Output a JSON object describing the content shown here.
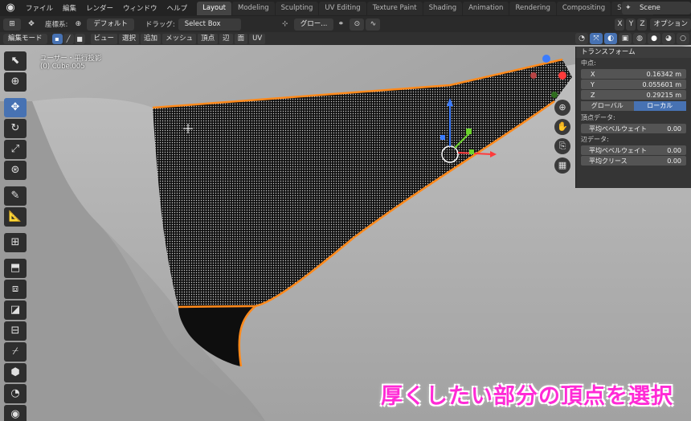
{
  "menu": [
    "ファイル",
    "編集",
    "レンダー",
    "ウィンドウ",
    "ヘルプ"
  ],
  "workspaces": [
    "Layout",
    "Modeling",
    "Sculpting",
    "UV Editing",
    "Texture Paint",
    "Shading",
    "Animation",
    "Rendering",
    "Compositing",
    "Scripting"
  ],
  "active_workspace": "Layout",
  "scene_name": "Scene",
  "toolbar2": {
    "coord_label": "座標系:",
    "coord_value": "デフォルト",
    "drag_label": "ドラッグ:",
    "drag_value": "Select Box",
    "pivot_value": "グロー...",
    "xyz": [
      "X",
      "Y",
      "Z"
    ],
    "options": "オプション"
  },
  "toolbar3": {
    "mode": "編集モード",
    "menus": [
      "ビュー",
      "選択",
      "追加",
      "メッシュ",
      "頂点",
      "辺",
      "面",
      "UV"
    ]
  },
  "viewport": {
    "view_name": "ユーザー・平行投影",
    "object_name": "(0) Cube.005"
  },
  "npanel": {
    "header": "トランスフォーム",
    "median_label": "中点:",
    "coords": [
      {
        "axis": "X",
        "value": "0.16342 m"
      },
      {
        "axis": "Y",
        "value": "0.055601 m"
      },
      {
        "axis": "Z",
        "value": "0.29215 m"
      }
    ],
    "space_global": "グローバル",
    "space_local": "ローカル",
    "vertex_data_label": "頂点データ:",
    "vertex_bevel_label": "平均ベベルウェイト",
    "vertex_bevel_value": "0.00",
    "edge_data_label": "辺データ:",
    "edge_bevel_label": "平均ベベルウェイト",
    "edge_bevel_value": "0.00",
    "edge_crease_label": "平均クリース",
    "edge_crease_value": "0.00"
  },
  "caption": "厚くしたい部分の頂点を選択",
  "colors": {
    "accent": "#4772b3",
    "selection": "#ff8a1c",
    "caption": "#ff2bd6"
  }
}
